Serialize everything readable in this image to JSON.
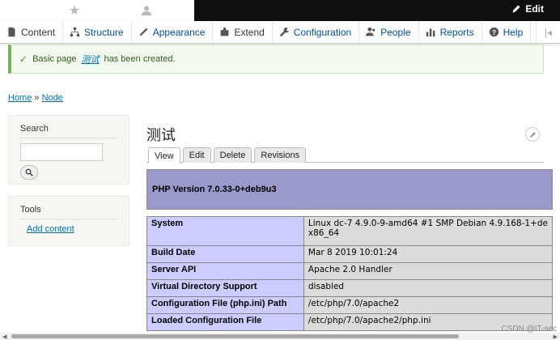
{
  "toolbar": {
    "edit_label": "Edit"
  },
  "tray": {
    "items": [
      {
        "label": "Content",
        "icon": "content-icon"
      },
      {
        "label": "Structure",
        "icon": "structure-icon"
      },
      {
        "label": "Appearance",
        "icon": "appearance-icon"
      },
      {
        "label": "Extend",
        "icon": "extend-icon"
      },
      {
        "label": "Configuration",
        "icon": "wrench-icon"
      },
      {
        "label": "People",
        "icon": "people-icon"
      },
      {
        "label": "Reports",
        "icon": "reports-icon"
      },
      {
        "label": "Help",
        "icon": "help-icon"
      }
    ]
  },
  "status": {
    "prefix": "Basic page",
    "title": "测试",
    "suffix": "has been created."
  },
  "breadcrumb": {
    "home": "Home",
    "sep": "»",
    "current": "Node"
  },
  "sidebar": {
    "search_title": "Search",
    "tools_title": "Tools",
    "add_content": "Add content"
  },
  "page": {
    "title": "测试",
    "tabs": [
      "View",
      "Edit",
      "Delete",
      "Revisions"
    ]
  },
  "phpinfo": {
    "version": "PHP Version 7.0.33-0+deb9u3",
    "rows": [
      {
        "key": "System",
        "value": "Linux dc-7 4.9.0-9-amd64 #1 SMP Debian 4.9.168-1+de",
        "value2": "x86_64"
      },
      {
        "key": "Build Date",
        "value": "Mar 8 2019 10:01:24"
      },
      {
        "key": "Server API",
        "value": "Apache 2.0 Handler"
      },
      {
        "key": "Virtual Directory Support",
        "value": "disabled"
      },
      {
        "key": "Configuration File (php.ini) Path",
        "value": "/etc/php/7.0/apache2"
      },
      {
        "key": "Loaded Configuration File",
        "value": "/etc/php/7.0/apache2/php.ini"
      }
    ]
  },
  "watermark": "CSDN @IT-sec"
}
